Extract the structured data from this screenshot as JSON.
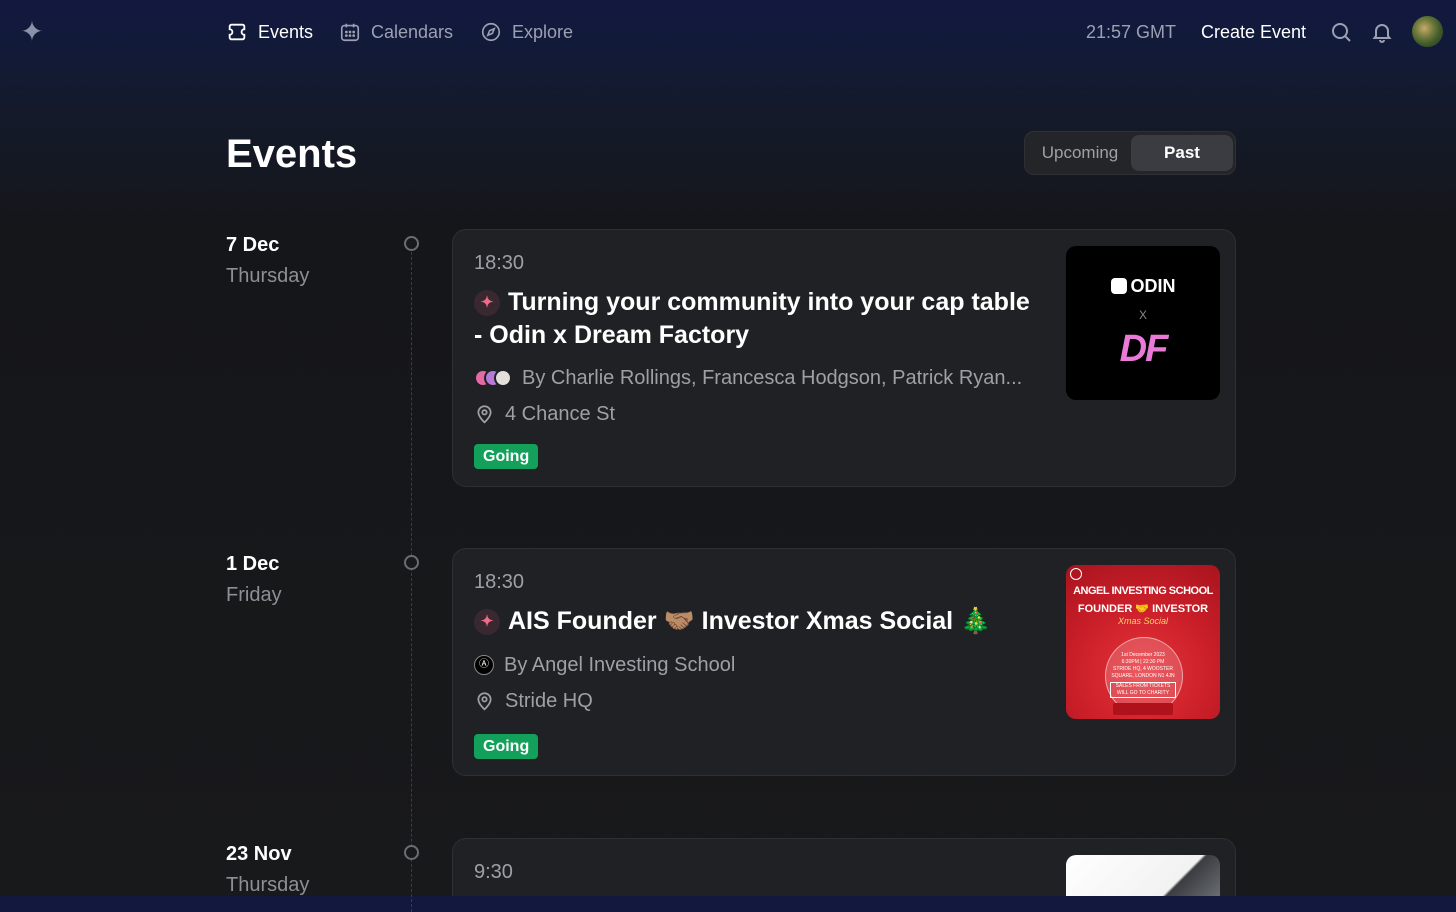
{
  "header": {
    "nav": [
      {
        "label": "Events",
        "icon": "ticket-icon",
        "active": true
      },
      {
        "label": "Calendars",
        "icon": "calendar-icon",
        "active": false
      },
      {
        "label": "Explore",
        "icon": "compass-icon",
        "active": false
      }
    ],
    "time": "21:57 GMT",
    "create_label": "Create Event",
    "icons": [
      "search-icon",
      "bell-icon"
    ]
  },
  "page": {
    "title": "Events",
    "toggle": {
      "upcoming": "Upcoming",
      "past": "Past",
      "selected": "Past"
    }
  },
  "colors": {
    "going": "#13a05a",
    "accent": "#f06a8a",
    "aisRed": "#d6202a",
    "odinPink": "#e97ad8"
  },
  "events": [
    {
      "date": "7 Dec",
      "weekday": "Thursday",
      "time": "18:30",
      "title": "Turning your community into your cap table - Odin x Dream Factory",
      "hosts": "By Charlie Rollings, Francesca Hodgson, Patrick Ryan...",
      "location": "4 Chance St",
      "status": "Going",
      "thumb": {
        "brand": "ODIN",
        "x": "X",
        "sub": "DF"
      }
    },
    {
      "date": "1 Dec",
      "weekday": "Friday",
      "time": "18:30",
      "title": "AIS Founder 🤝🏽 Investor Xmas Social 🎄",
      "hosts": "By Angel Investing School",
      "location": "Stride HQ",
      "status": "Going",
      "thumb": {
        "line1": "ANGEL INVESTING SCHOOL",
        "line2": "FOUNDER 🤝 INVESTOR",
        "script": "Xmas Social",
        "date": "1st December 2023",
        "time": "6:30PM | 22:30 PM",
        "venue": "STRIDE HQ, 4 WOOSTER SQUARE, LONDON N1 4JN",
        "note": "SALES FROM TICKETS WILL GO TO CHARITY"
      }
    },
    {
      "date": "23 Nov",
      "weekday": "Thursday",
      "time": "9:30"
    }
  ]
}
